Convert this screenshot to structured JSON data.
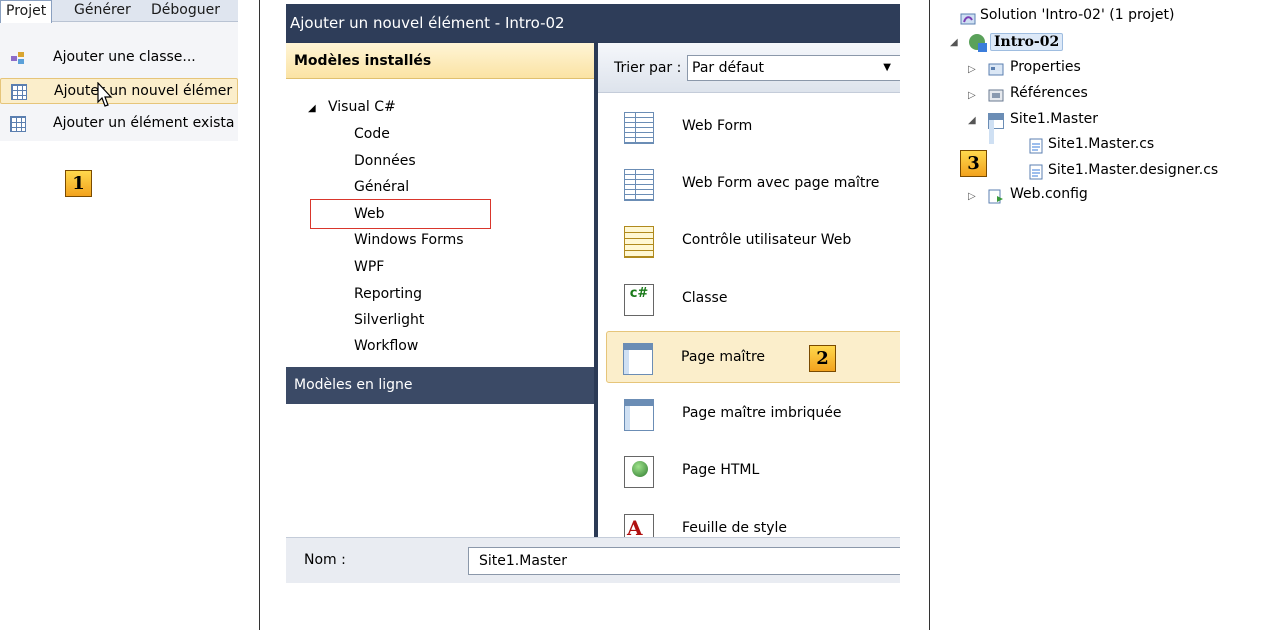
{
  "menu": {
    "bar": [
      "Projet",
      "Générer",
      "Déboguer"
    ],
    "items": [
      {
        "label": "Ajouter une classe...",
        "icon": "add-class-icon"
      },
      {
        "label": "Ajouter un nouvel élémer",
        "icon": "new-item-icon"
      },
      {
        "label": "Ajouter un élément exista",
        "icon": "existing-item-icon"
      }
    ],
    "badge": "1"
  },
  "dialog": {
    "title": "Ajouter un nouvel élément - Intro-02",
    "installed_header": "Modèles installés",
    "tree_root": "Visual C#",
    "categories": [
      "Code",
      "Données",
      "Général",
      "Web",
      "Windows Forms",
      "WPF",
      "Reporting",
      "Silverlight",
      "Workflow"
    ],
    "online_templates": "Modèles en ligne",
    "sort_label": "Trier par :",
    "sort_value": "Par défaut",
    "templates": [
      "Web Form",
      "Web Form avec page maître",
      "Contrôle utilisateur Web",
      "Classe",
      "Page maître",
      "Page maître imbriquée",
      "Page HTML",
      "Feuille de style"
    ],
    "selected_template": "Page maître",
    "badge": "2",
    "name_label": "Nom :",
    "name_value": "Site1.Master",
    "cs_icon_text": "c#"
  },
  "solution": {
    "solution_label": "Solution 'Intro-02' (1 projet)",
    "project": "Intro-02",
    "items": [
      "Properties",
      "Références",
      "Site1.Master",
      "Site1.Master.cs",
      "Site1.Master.designer.cs",
      "Web.config"
    ],
    "badge": "3"
  },
  "colors": {
    "selection": "#fbeecb",
    "dialog_dark": "#2e3d59",
    "highlight_box": "#d9362c",
    "badge": "#f2a21d"
  }
}
